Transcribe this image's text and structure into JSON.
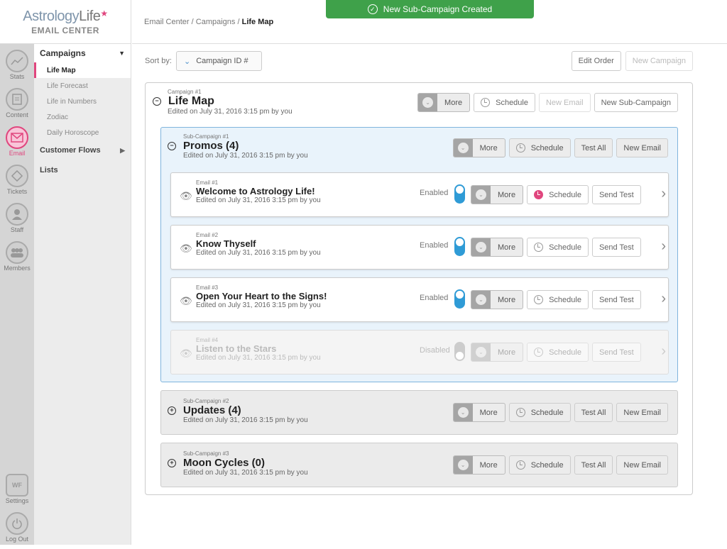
{
  "brand": {
    "title_a": "Astrology",
    "title_b": "Life",
    "subtitle": "EMAIL CENTER"
  },
  "rail": [
    {
      "label": "Stats",
      "icon": "stats-icon"
    },
    {
      "label": "Content",
      "icon": "content-icon"
    },
    {
      "label": "Email",
      "icon": "email-icon",
      "active": true
    },
    {
      "label": "Tickets",
      "icon": "tickets-icon"
    },
    {
      "label": "Staff",
      "icon": "staff-icon"
    },
    {
      "label": "Members",
      "icon": "members-icon"
    },
    {
      "label": "Settings",
      "icon": "settings-icon",
      "glyph": "WF"
    },
    {
      "label": "Log Out",
      "icon": "logout-icon"
    }
  ],
  "sidebar": {
    "campaigns_label": "Campaigns",
    "items": [
      "Life Map",
      "Life Forecast",
      "Life in Numbers",
      "Zodiac",
      "Daily Horoscope"
    ],
    "customer_flows": "Customer Flows",
    "lists": "Lists"
  },
  "breadcrumb": {
    "root": "Email Center",
    "mid": "Campaigns",
    "current": "Life Map",
    "sep": "/"
  },
  "toast": {
    "text": "New Sub-Campaign Created"
  },
  "sort": {
    "label": "Sort by:",
    "value": "Campaign ID #"
  },
  "toolbar": {
    "edit_order": "Edit Order",
    "new_campaign": "New Campaign"
  },
  "labels": {
    "more": "More",
    "schedule": "Schedule",
    "new_email": "New Email",
    "new_sub_campaign": "New Sub-Campaign",
    "test_all": "Test All",
    "send_test": "Send Test"
  },
  "campaign": {
    "kicker": "Campaign #1",
    "title": "Life Map",
    "edited": "Edited on July 31, 2016 3:15 pm by you"
  },
  "subs": [
    {
      "kicker": "Sub-Campaign #1",
      "title": "Promos (4)",
      "edited": "Edited on July 31, 2016 3:15 pm by you"
    },
    {
      "kicker": "Sub-Campaign #2",
      "title": "Updates (4)",
      "edited": "Edited on July 31, 2016 3:15 pm by you"
    },
    {
      "kicker": "Sub-Campaign #3",
      "title": "Moon Cycles (0)",
      "edited": "Edited on July 31, 2016 3:15 pm by you"
    }
  ],
  "emails": [
    {
      "kicker": "Email #1",
      "title": "Welcome to Astrology Life!",
      "edited": "Edited on July 31, 2016 3:15 pm by you",
      "status": "Enabled"
    },
    {
      "kicker": "Email #2",
      "title": "Know Thyself",
      "edited": "Edited on July 31, 2016 3:15 pm by you",
      "status": "Enabled"
    },
    {
      "kicker": "Email #3",
      "title": "Open Your Heart to the Signs!",
      "edited": "Edited on July 31, 2016 3:15 pm by you",
      "status": "Enabled"
    },
    {
      "kicker": "Email #4",
      "title": "Listen to the Stars",
      "edited": "Edited on July 31, 2016 3:15 pm by you",
      "status": "Disabled"
    }
  ],
  "colors": {
    "accent": "#e0467e",
    "toast": "#3fa14a",
    "toggle_on": "#2f9bd6"
  }
}
